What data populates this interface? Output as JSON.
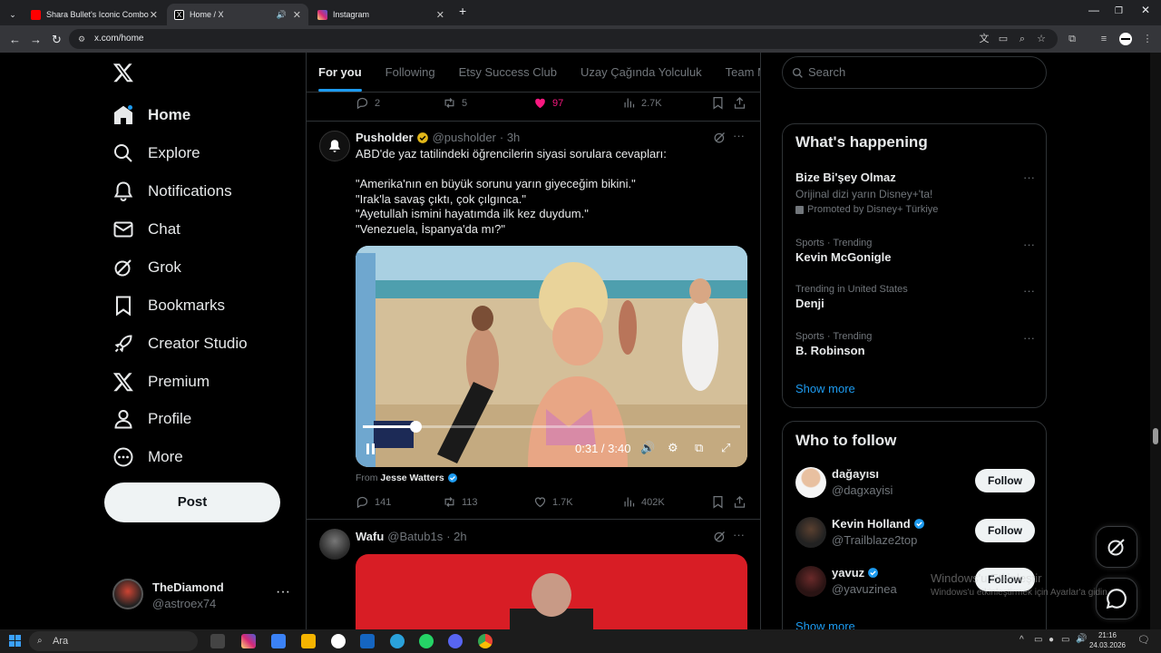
{
  "browser": {
    "tabs": [
      {
        "title": "Shara Bullet's Iconic Combo",
        "favicon_color": "#ff0000"
      },
      {
        "title": "Home / X",
        "favicon_color": "#ffffff"
      },
      {
        "title": "Instagram",
        "favicon_color": "#d62976"
      }
    ],
    "url": "x.com/home"
  },
  "nav": {
    "items": [
      {
        "label": "Home",
        "icon": "home-icon"
      },
      {
        "label": "Explore",
        "icon": "search-icon"
      },
      {
        "label": "Notifications",
        "icon": "bell-icon"
      },
      {
        "label": "Chat",
        "icon": "mail-icon"
      },
      {
        "label": "Grok",
        "icon": "grok-icon"
      },
      {
        "label": "Bookmarks",
        "icon": "bookmark-icon"
      },
      {
        "label": "Creator Studio",
        "icon": "rocket-icon"
      },
      {
        "label": "Premium",
        "icon": "x-icon"
      },
      {
        "label": "Profile",
        "icon": "person-icon"
      },
      {
        "label": "More",
        "icon": "more-circle-icon"
      }
    ],
    "post_label": "Post",
    "account": {
      "name": "TheDiamond",
      "handle": "@astroex74"
    }
  },
  "feed": {
    "tabs": [
      "For you",
      "Following",
      "Etsy Success Club",
      "Uzay Çağında Yolculuk",
      "Team M"
    ],
    "prev_tweet_actions": {
      "replies": "2",
      "reposts": "5",
      "likes": "97",
      "views": "2.7K"
    },
    "tweet": {
      "name": "Pusholder",
      "handle": "@pusholder",
      "time": "· 3h",
      "text": "ABD'de yaz tatilindeki öğrencilerin siyasi sorulara cevapları:\n\n\"Amerika'nın en büyük sorunu yarın giyeceğim bikini.\"\n\"Irak'la savaş çıktı, çok çılgınca.\"\n\"Ayetullah ismini hayatımda ilk kez duydum.\"\n\"Venezuela, İspanya'da mı?\"",
      "video_time": "0:31 / 3:40",
      "video_progress": 0.14,
      "from_label": "From",
      "from_name": "Jesse Watters",
      "replies": "141",
      "reposts": "113",
      "likes": "1.7K",
      "views": "402K"
    },
    "tweet2": {
      "name": "Wafu",
      "handle": "@Batub1s",
      "time": "· 2h"
    }
  },
  "search": {
    "placeholder": "Search"
  },
  "happening": {
    "title": "What's happening",
    "promo": {
      "title": "Bize Bi'şey Olmaz",
      "subtitle": "Orijinal dizi yarın Disney+'ta!",
      "promoted": "Promoted by Disney+ Türkiye"
    },
    "trends": [
      {
        "context": "Sports · Trending",
        "name": "Kevin McGonigle"
      },
      {
        "context": "Trending in United States",
        "name": "Denji"
      },
      {
        "context": "Sports · Trending",
        "name": "B. Robinson"
      }
    ],
    "show_more": "Show more"
  },
  "who_to_follow": {
    "title": "Who to follow",
    "users": [
      {
        "name": "dağayısı",
        "handle": "@dagxayisi",
        "verified": false
      },
      {
        "name": "Kevin Holland",
        "handle": "@Trailblaze2top",
        "verified": true
      },
      {
        "name": "yavuz",
        "handle": "@yavuzinea",
        "verified": true
      }
    ],
    "follow_label": "Follow",
    "show_more": "Show more"
  },
  "watermark": {
    "line1": "Windows'u Etkinleştir",
    "line2": "Windows'u etkinleştirmek için Ayarlar'a gidin."
  },
  "taskbar": {
    "search": "Ara",
    "time": "21:16",
    "date": "24.03.2026"
  },
  "colors": {
    "accent": "#1d9bf0",
    "like": "#f91880",
    "bg": "#000000"
  }
}
